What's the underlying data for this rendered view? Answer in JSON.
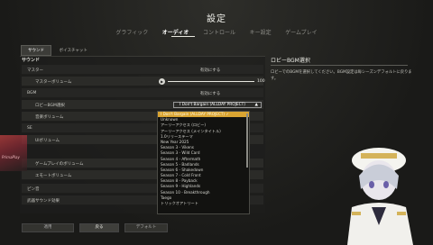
{
  "title": "設定",
  "nav": [
    {
      "label": "グラフィック",
      "active": false
    },
    {
      "label": "オーディオ",
      "active": true
    },
    {
      "label": "コントロール",
      "active": false
    },
    {
      "label": "キー設定",
      "active": false
    },
    {
      "label": "ゲームプレイ",
      "active": false
    }
  ],
  "subtabs": [
    {
      "label": "サウンド",
      "active": true
    },
    {
      "label": "ボイスチャット",
      "active": false
    }
  ],
  "section": "サウンド",
  "rows": {
    "master": {
      "label": "マスター",
      "value": "有効にする"
    },
    "master_volume": {
      "label": "マスターボリューム",
      "value": "100",
      "fraction": 1.0
    },
    "bgm": {
      "label": "BGM",
      "value": "有効にする"
    },
    "lobby_bgm": {
      "label": "ロビーBGM選択",
      "value": "I Don't Bargain (ALLDAY PROJECT)"
    },
    "music_volume": {
      "label": "音楽ボリューム"
    },
    "se": {
      "label": "SE"
    },
    "ui_volume": {
      "label": "UIボリューム"
    },
    "gameplay_volume": {
      "label": "ゲームプレイのボリューム"
    },
    "emote_volume": {
      "label": "エモートボリューム"
    },
    "pin": {
      "label": "ピン音"
    },
    "weapon_sound": {
      "label": "武器サウンド効果"
    }
  },
  "dropdown": {
    "selected": "I Don't Bargain (ALLDAY PROJECT) ✓",
    "options": [
      "Unknown",
      "アーリーアクセス (ロビー)",
      "アーリーアクセス (メインタイトル)",
      "1.0リリーステーマ",
      "New Year 2025",
      "Season 3 - Vikens",
      "Season 3 - Wild Card",
      "Season 4 - Aftermath",
      "Season 5 - Badlands",
      "Season 6 - Shakedown",
      "Season 7 - Cold Front",
      "Season 8 - Payback",
      "Season 9 - Highlands",
      "Season 10 - Breakthrough",
      "Taego",
      "トリックオアトリート"
    ]
  },
  "right": {
    "title": "ロビーBGM選択",
    "desc": "ロビーでのBGMを選択してください。BGM設定は毎シーズンデフォルトに戻ります。"
  },
  "buttons": {
    "apply": "適用",
    "back": "戻る",
    "default": "デフォルト"
  },
  "side_text": "PrimaPlay"
}
